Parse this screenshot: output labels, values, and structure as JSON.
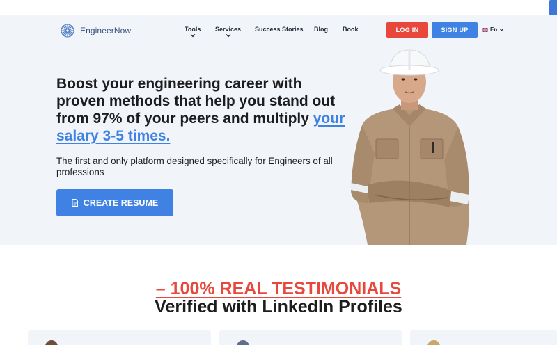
{
  "header": {
    "logo_text": "EngineerNow",
    "nav": [
      {
        "label": "Tools",
        "has_dropdown": true
      },
      {
        "label": "Services",
        "has_dropdown": true
      },
      {
        "label": "Success Stories",
        "has_dropdown": false
      },
      {
        "label": "Blog",
        "has_dropdown": false
      },
      {
        "label": "Book",
        "has_dropdown": false
      }
    ],
    "login_label": "LOG IN",
    "signup_label": "SIGN UP",
    "language": "En"
  },
  "hero": {
    "headline_main": "Boost your engineering career with proven methods that help you stand out from 97% of your peers and multiply ",
    "headline_accent": "your salary 3-5 times.",
    "subtitle": "The first and only platform designed specifically for Engineers of all professions",
    "cta_label": "CREATE RESUME"
  },
  "testimonials": {
    "title": "– 100% REAL TESTIMONIALS",
    "subtitle": "Verified with LinkedIn Profiles"
  },
  "colors": {
    "accent_blue": "#3f82e4",
    "accent_red": "#e8483c",
    "hero_bg": "#f1f4f8"
  },
  "icons": {
    "logo": "sunburst-logo-icon",
    "dropdown": "chevron-down-icon",
    "flag": "uk-flag-icon",
    "cta": "document-icon",
    "feedback": "feedback-tab-icon"
  }
}
